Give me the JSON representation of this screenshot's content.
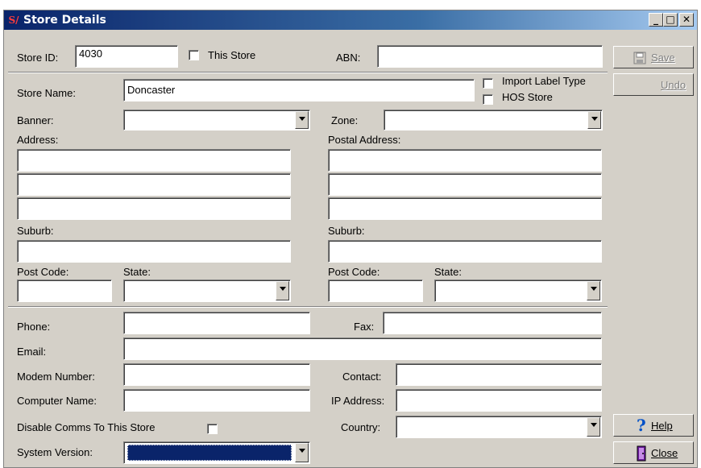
{
  "window": {
    "title": "Store Details",
    "icon_text": "S/",
    "minimize": "_",
    "maximize": "□",
    "close": "✕"
  },
  "store_id": {
    "label": "Store ID:",
    "value": "4030"
  },
  "this_store": {
    "label": "This Store"
  },
  "abn": {
    "label": "ABN:",
    "value": ""
  },
  "store_name": {
    "label": "Store Name:",
    "value": "Doncaster"
  },
  "import_label_type": {
    "label": "Import Label Type"
  },
  "hos_store": {
    "label": "HOS Store"
  },
  "banner": {
    "label": "Banner:",
    "value": ""
  },
  "zone": {
    "label": "Zone:",
    "value": ""
  },
  "address": {
    "label": "Address:"
  },
  "postal_address": {
    "label": "Postal Address:"
  },
  "suburb": {
    "label": "Suburb:"
  },
  "postal_suburb": {
    "label": "Suburb:"
  },
  "post_code": {
    "label": "Post Code:"
  },
  "state": {
    "label": "State:"
  },
  "postal_post_code": {
    "label": "Post Code:"
  },
  "postal_state": {
    "label": "State:"
  },
  "phone": {
    "label": "Phone:"
  },
  "fax": {
    "label": "Fax:"
  },
  "email": {
    "label": "Email:"
  },
  "modem_number": {
    "label": "Modem Number:"
  },
  "contact": {
    "label": "Contact:"
  },
  "computer_name": {
    "label": "Computer Name:"
  },
  "ip_address": {
    "label": "IP Address:"
  },
  "disable_comms": {
    "label": "Disable Comms To This Store"
  },
  "country": {
    "label": "Country:"
  },
  "system_version": {
    "label": "System Version:"
  },
  "buttons": {
    "save": "Save",
    "undo": "Undo",
    "help": "Help",
    "close": "Close"
  },
  "colors": {
    "face": "#d4d0c8",
    "title_start": "#0a246a",
    "title_end": "#a6caf0",
    "selection": "#0a246a"
  }
}
